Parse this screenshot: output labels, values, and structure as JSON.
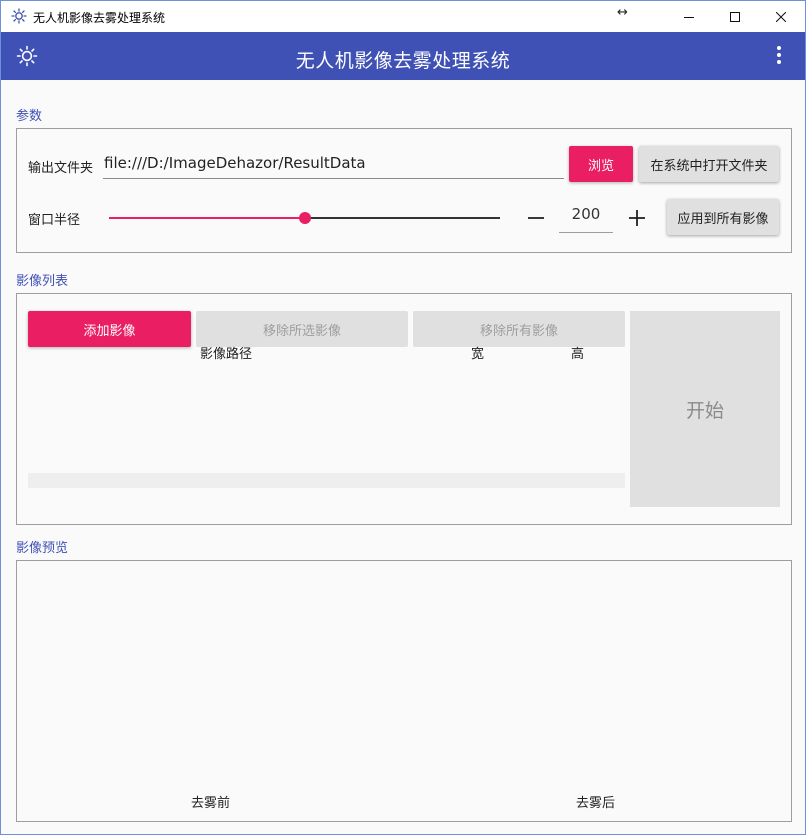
{
  "window": {
    "title": "无人机影像去雾处理系统",
    "resize_glyph": "↔"
  },
  "appbar": {
    "title": "无人机影像去雾处理系统"
  },
  "params": {
    "section_label": "参数",
    "output_folder_label": "输出文件夹",
    "output_folder_value": "file:///D:/ImageDehazor/ResultData",
    "browse_label": "浏览",
    "open_in_system_label": "在系统中打开文件夹",
    "window_radius_label": "窗口半径",
    "window_radius_value": "200",
    "slider_fraction": 0.5,
    "apply_all_label": "应用到所有影像"
  },
  "image_list": {
    "section_label": "影像列表",
    "add_label": "添加影像",
    "remove_selected_label": "移除所选影像",
    "remove_all_label": "移除所有影像",
    "columns": [
      "影像路径",
      "宽",
      "高"
    ],
    "start_label": "开始"
  },
  "preview": {
    "section_label": "影像预览",
    "before_label": "去雾前",
    "after_label": "去雾后"
  },
  "colors": {
    "primary": "#3f51b5",
    "accent": "#e91e63"
  },
  "icons": {
    "app": "sun-gear-icon",
    "settings": "sun-gear-icon",
    "menu": "more-vert-icon"
  }
}
